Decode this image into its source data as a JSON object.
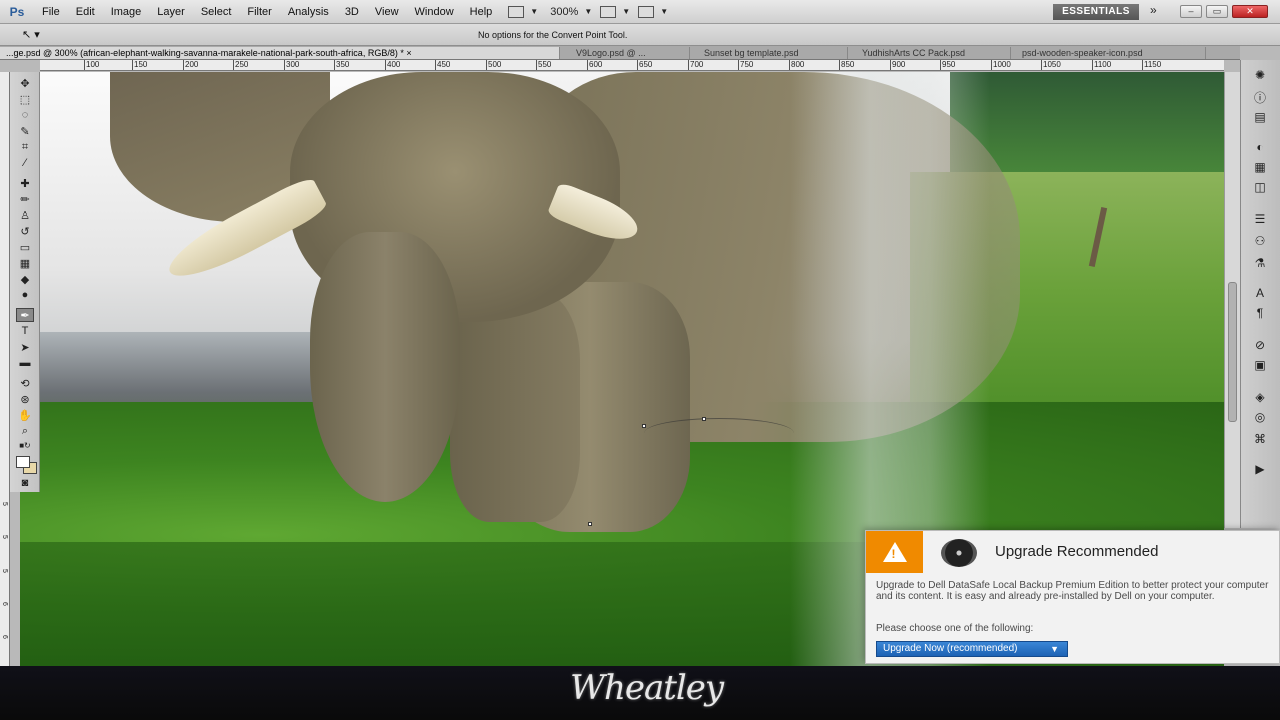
{
  "app": {
    "logo": "Ps"
  },
  "menu": [
    "File",
    "Edit",
    "Image",
    "Layer",
    "Select",
    "Filter",
    "Analysis",
    "3D",
    "View",
    "Window",
    "Help"
  ],
  "toolbar": {
    "zoom": "300%"
  },
  "workspace": {
    "label": "ESSENTIALS",
    "more": "»"
  },
  "window_controls": {
    "minimize": "–",
    "restore": "▭",
    "close": "✕"
  },
  "options_bar": {
    "tool_icon": "convert-point-icon",
    "message": "No options for the Convert Point Tool."
  },
  "tabs": [
    "...ge.psd @ 300% (african-elephant-walking-savanna-marakele-national-park-south-africa, RGB/8) * ×",
    "V9Logo.psd @ ...",
    "Sunset bg template.psd",
    "YudhishArts CC Pack.psd",
    "psd-wooden-speaker-icon.psd"
  ],
  "ruler_h": [
    "100",
    "150",
    "200",
    "250",
    "300",
    "350",
    "400",
    "450",
    "500",
    "550",
    "600",
    "650",
    "700",
    "750",
    "800",
    "850",
    "900",
    "950",
    "1000",
    "1050",
    "1100",
    "1150"
  ],
  "ruler_v": [
    "5",
    "5",
    "5",
    "6",
    "6"
  ],
  "notification": {
    "title": "Upgrade Recommended",
    "body": "Upgrade to Dell DataSafe Local Backup Premium Edition to better protect your computer and its content. It is easy and already pre-installed by Dell on your computer.",
    "prompt": "Please choose one of the following:",
    "button": "Upgrade Now (recommended)"
  },
  "watermark": "Wheatley",
  "colors": {
    "accent": "#f08a00",
    "button": "#1d62b4",
    "essentials_bg": "#555555"
  }
}
